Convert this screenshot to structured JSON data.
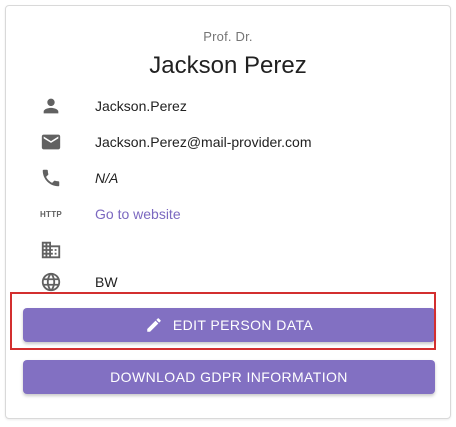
{
  "person": {
    "title_prefix": "Prof. Dr.",
    "full_name": "Jackson Perez"
  },
  "details": [
    {
      "icon": "person-icon",
      "value": "Jackson.Perez"
    },
    {
      "icon": "email-icon",
      "value": "Jackson.Perez@mail-provider.com"
    },
    {
      "icon": "phone-icon",
      "value": "N/A"
    },
    {
      "icon": "http-icon",
      "icon_text": "HTTP",
      "value": "Go to website"
    },
    {
      "icon": "building-icon",
      "value": ""
    },
    {
      "icon": "globe-icon",
      "value": "BW"
    }
  ],
  "actions": {
    "edit_label": "EDIT PERSON DATA",
    "gdpr_label": "DOWNLOAD GDPR INFORMATION"
  },
  "colors": {
    "accent": "#8270c2",
    "link": "#7b68c0",
    "highlight": "#d32f2f"
  }
}
